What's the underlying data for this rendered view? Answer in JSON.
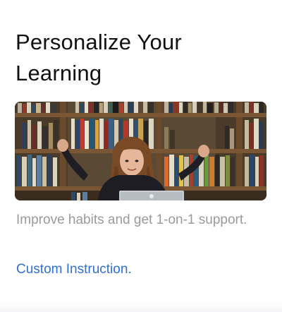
{
  "card": {
    "title": "Personalize Your Learning",
    "image_subject": "student-at-laptop-celebrating-in-front-of-bookshelves",
    "description": "Improve habits and get 1-on-1 support.",
    "link_label": "Custom Instruction."
  },
  "colors": {
    "title": "#111111",
    "description": "#9a9a9a",
    "link": "#2f6fd6",
    "background": "#ffffff"
  }
}
